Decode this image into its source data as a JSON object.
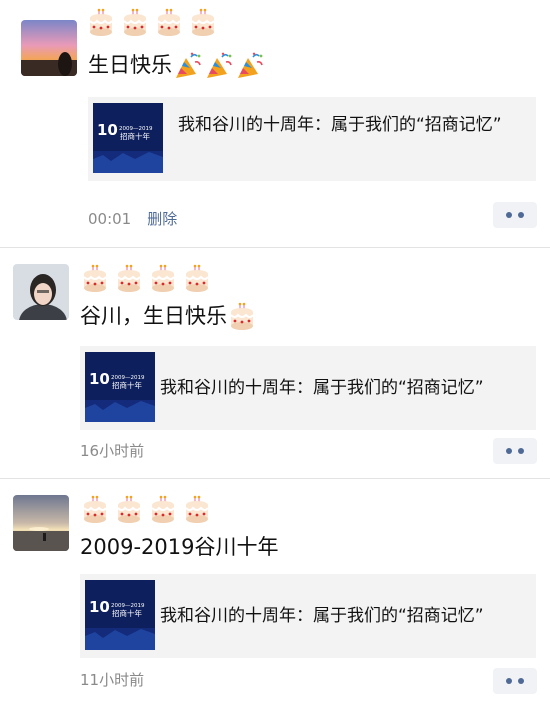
{
  "posts": [
    {
      "text": "生日快乐",
      "share_title": "我和谷川的十周年：属于我们的“招商记忆”",
      "time": "00:01",
      "delete_label": "删除",
      "thumb": {
        "big": "10",
        "sub": "2009—2019",
        "title": "招商十年"
      }
    },
    {
      "text": "谷川，生日快乐",
      "share_title": "我和谷川的十周年：属于我们的“招商记忆”",
      "time": "16小时前",
      "thumb": {
        "big": "10",
        "sub": "2009—2019",
        "title": "招商十年"
      }
    },
    {
      "text": "2009-2019谷川十年",
      "share_title": "我和谷川的十周年：属于我们的“招商记忆”",
      "time": "11小时前",
      "thumb": {
        "big": "10",
        "sub": "2009—2019",
        "title": "招商十年"
      }
    }
  ],
  "icons": {
    "cake": "birthday-cake-icon",
    "party": "party-popper-icon",
    "more": "more-dots-icon"
  },
  "colors": {
    "link": "#4f6a95",
    "meta": "#8a8a8a",
    "card_bg": "#f3f3f3"
  }
}
